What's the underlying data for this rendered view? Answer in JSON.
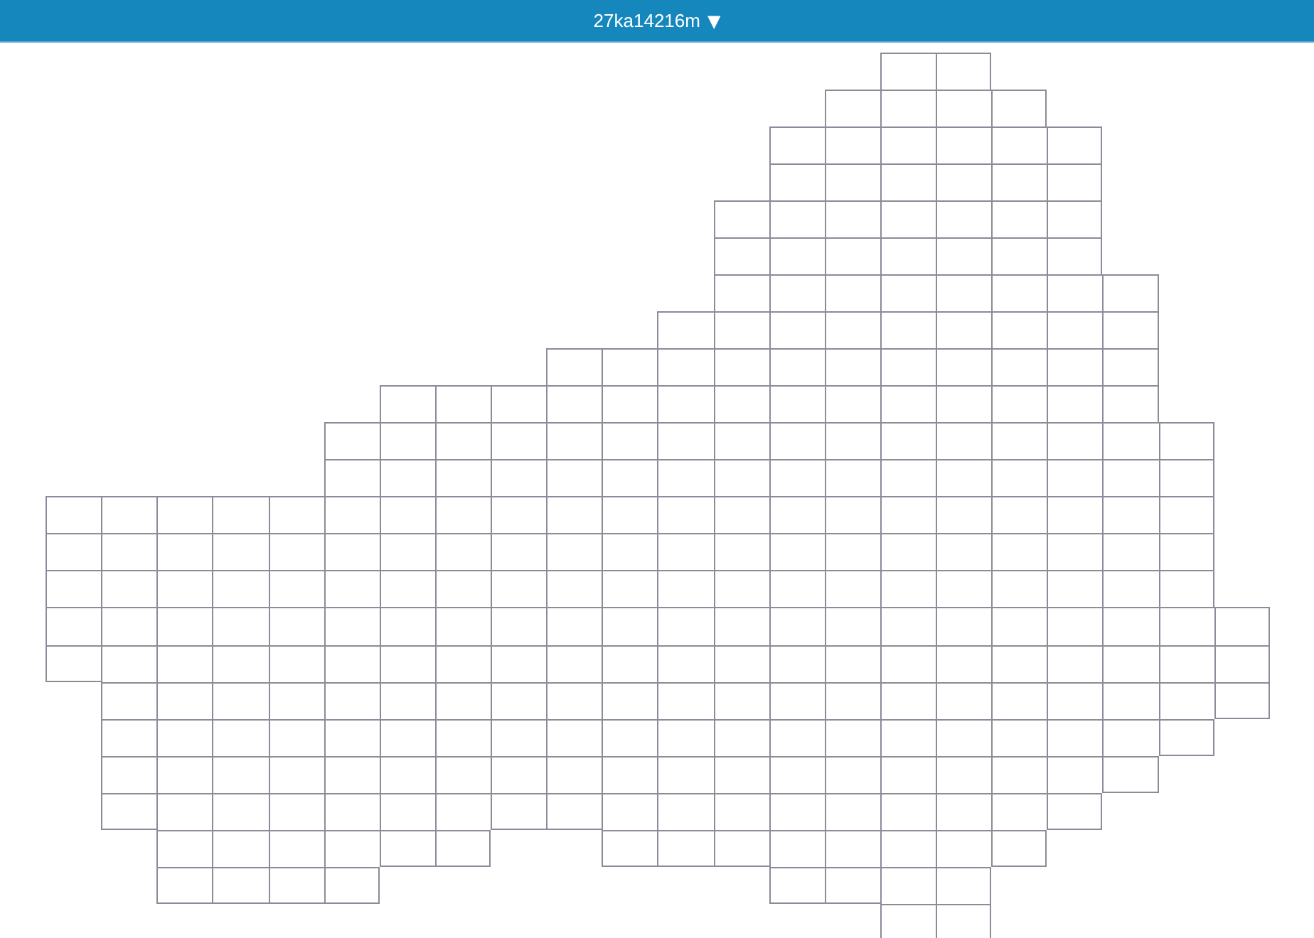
{
  "header": {
    "title": "27ka14216m",
    "caret": "▼"
  },
  "grid": {
    "rows": [
      [
        {
          "kind": "gap"
        },
        {
          "kind": "gap"
        },
        {
          "kind": "gap"
        },
        {
          "kind": "gap"
        },
        {
          "kind": "gap"
        },
        {
          "kind": "gap"
        },
        {
          "kind": "gap"
        },
        {
          "kind": "gap"
        },
        {
          "kind": "gap"
        },
        {
          "kind": "gap"
        },
        {
          "kind": "gap"
        },
        {
          "kind": "gap"
        },
        {
          "kind": "gap"
        },
        {
          "kind": "gap"
        },
        {
          "kind": "gap"
        },
        {
          "kind": "tile"
        },
        {
          "kind": "tile"
        }
      ],
      [
        {
          "kind": "gap"
        },
        {
          "kind": "gap"
        },
        {
          "kind": "gap"
        },
        {
          "kind": "gap"
        },
        {
          "kind": "gap"
        },
        {
          "kind": "gap"
        },
        {
          "kind": "gap"
        },
        {
          "kind": "gap"
        },
        {
          "kind": "gap"
        },
        {
          "kind": "gap"
        },
        {
          "kind": "gap"
        },
        {
          "kind": "gap"
        },
        {
          "kind": "gap"
        },
        {
          "kind": "gap"
        },
        {
          "kind": "tile"
        },
        {
          "kind": "tile"
        },
        {
          "kind": "tile"
        },
        {
          "kind": "tile"
        }
      ],
      [
        {
          "kind": "gap"
        },
        {
          "kind": "gap"
        },
        {
          "kind": "gap"
        },
        {
          "kind": "gap"
        },
        {
          "kind": "gap"
        },
        {
          "kind": "gap"
        },
        {
          "kind": "gap"
        },
        {
          "kind": "gap"
        },
        {
          "kind": "gap"
        },
        {
          "kind": "gap"
        },
        {
          "kind": "gap"
        },
        {
          "kind": "gap"
        },
        {
          "kind": "gap"
        },
        {
          "kind": "tile"
        },
        {
          "kind": "tile"
        },
        {
          "kind": "tile"
        },
        {
          "kind": "tile"
        },
        {
          "kind": "tile"
        },
        {
          "kind": "tile"
        }
      ],
      [
        {
          "kind": "gap"
        },
        {
          "kind": "gap"
        },
        {
          "kind": "gap"
        },
        {
          "kind": "gap"
        },
        {
          "kind": "gap"
        },
        {
          "kind": "gap"
        },
        {
          "kind": "gap"
        },
        {
          "kind": "gap"
        },
        {
          "kind": "gap"
        },
        {
          "kind": "gap"
        },
        {
          "kind": "gap"
        },
        {
          "kind": "gap"
        },
        {
          "kind": "gap"
        },
        {
          "kind": "tile"
        },
        {
          "kind": "tile"
        },
        {
          "kind": "tile"
        },
        {
          "kind": "tile"
        },
        {
          "kind": "tile"
        },
        {
          "kind": "tile"
        }
      ],
      [
        {
          "kind": "gap"
        },
        {
          "kind": "gap"
        },
        {
          "kind": "gap"
        },
        {
          "kind": "gap"
        },
        {
          "kind": "gap"
        },
        {
          "kind": "gap"
        },
        {
          "kind": "gap"
        },
        {
          "kind": "gap"
        },
        {
          "kind": "gap"
        },
        {
          "kind": "gap"
        },
        {
          "kind": "gap"
        },
        {
          "kind": "gap"
        },
        {
          "kind": "tile"
        },
        {
          "kind": "tile"
        },
        {
          "kind": "tile"
        },
        {
          "kind": "tile"
        },
        {
          "kind": "tile"
        },
        {
          "kind": "tile"
        },
        {
          "kind": "tile"
        }
      ],
      [
        {
          "kind": "gap"
        },
        {
          "kind": "gap"
        },
        {
          "kind": "gap"
        },
        {
          "kind": "gap"
        },
        {
          "kind": "gap"
        },
        {
          "kind": "gap"
        },
        {
          "kind": "gap"
        },
        {
          "kind": "gap"
        },
        {
          "kind": "gap"
        },
        {
          "kind": "gap"
        },
        {
          "kind": "gap"
        },
        {
          "kind": "gap"
        },
        {
          "kind": "tile"
        },
        {
          "kind": "tile"
        },
        {
          "kind": "tile"
        },
        {
          "kind": "tile"
        },
        {
          "kind": "tile"
        },
        {
          "kind": "tile"
        },
        {
          "kind": "tile"
        }
      ],
      [
        {
          "kind": "gap"
        },
        {
          "kind": "gap"
        },
        {
          "kind": "gap"
        },
        {
          "kind": "gap"
        },
        {
          "kind": "gap"
        },
        {
          "kind": "gap"
        },
        {
          "kind": "gap"
        },
        {
          "kind": "gap"
        },
        {
          "kind": "gap"
        },
        {
          "kind": "gap"
        },
        {
          "kind": "gap"
        },
        {
          "kind": "gap"
        },
        {
          "kind": "tile"
        },
        {
          "kind": "tile"
        },
        {
          "kind": "tile"
        },
        {
          "kind": "tile"
        },
        {
          "kind": "tile"
        },
        {
          "kind": "tile"
        },
        {
          "kind": "tile"
        },
        {
          "kind": "tile"
        }
      ],
      [
        {
          "kind": "gap"
        },
        {
          "kind": "gap"
        },
        {
          "kind": "gap"
        },
        {
          "kind": "gap"
        },
        {
          "kind": "gap"
        },
        {
          "kind": "gap"
        },
        {
          "kind": "gap"
        },
        {
          "kind": "gap"
        },
        {
          "kind": "gap"
        },
        {
          "kind": "gap"
        },
        {
          "kind": "gap"
        },
        {
          "kind": "tile"
        },
        {
          "kind": "tile"
        },
        {
          "kind": "tile"
        },
        {
          "kind": "tile"
        },
        {
          "kind": "tile"
        },
        {
          "kind": "tile"
        },
        {
          "kind": "tile"
        },
        {
          "kind": "tile"
        },
        {
          "kind": "tile"
        }
      ],
      [
        {
          "kind": "gap"
        },
        {
          "kind": "gap"
        },
        {
          "kind": "gap"
        },
        {
          "kind": "gap"
        },
        {
          "kind": "gap"
        },
        {
          "kind": "gap"
        },
        {
          "kind": "gap"
        },
        {
          "kind": "gap"
        },
        {
          "kind": "gap"
        },
        {
          "kind": "tile"
        },
        {
          "kind": "tile"
        },
        {
          "kind": "tile"
        },
        {
          "kind": "tile"
        },
        {
          "kind": "tile"
        },
        {
          "kind": "tile"
        },
        {
          "kind": "tile"
        },
        {
          "kind": "tile"
        },
        {
          "kind": "tile"
        },
        {
          "kind": "tile"
        },
        {
          "kind": "tile"
        }
      ],
      [
        {
          "kind": "gap"
        },
        {
          "kind": "gap"
        },
        {
          "kind": "gap"
        },
        {
          "kind": "gap"
        },
        {
          "kind": "gap"
        },
        {
          "kind": "gap"
        },
        {
          "kind": "tile"
        },
        {
          "kind": "tile"
        },
        {
          "kind": "tile"
        },
        {
          "kind": "tile"
        },
        {
          "kind": "tile"
        },
        {
          "kind": "tile"
        },
        {
          "kind": "tile"
        },
        {
          "kind": "tile"
        },
        {
          "kind": "tile"
        },
        {
          "kind": "tile"
        },
        {
          "kind": "tile"
        },
        {
          "kind": "tile"
        },
        {
          "kind": "tile"
        },
        {
          "kind": "tile"
        }
      ],
      [
        {
          "kind": "gap"
        },
        {
          "kind": "gap"
        },
        {
          "kind": "gap"
        },
        {
          "kind": "gap"
        },
        {
          "kind": "gap"
        },
        {
          "kind": "tile"
        },
        {
          "kind": "tile"
        },
        {
          "kind": "tile"
        },
        {
          "kind": "tile"
        },
        {
          "kind": "tile"
        },
        {
          "kind": "tile"
        },
        {
          "kind": "tile"
        },
        {
          "kind": "tile"
        },
        {
          "kind": "tile"
        },
        {
          "kind": "tile"
        },
        {
          "kind": "tile"
        },
        {
          "kind": "tile"
        },
        {
          "kind": "tile"
        },
        {
          "kind": "tile"
        },
        {
          "kind": "tile"
        },
        {
          "kind": "tile"
        }
      ],
      [
        {
          "kind": "gap"
        },
        {
          "kind": "gap"
        },
        {
          "kind": "gap"
        },
        {
          "kind": "gap"
        },
        {
          "kind": "gap"
        },
        {
          "kind": "tile"
        },
        {
          "kind": "tile"
        },
        {
          "kind": "tile"
        },
        {
          "kind": "tile"
        },
        {
          "kind": "tile"
        },
        {
          "kind": "tile"
        },
        {
          "kind": "tile"
        },
        {
          "kind": "tile"
        },
        {
          "kind": "tile"
        },
        {
          "kind": "tile"
        },
        {
          "kind": "tile"
        },
        {
          "kind": "tile"
        },
        {
          "kind": "tile"
        },
        {
          "kind": "tile"
        },
        {
          "kind": "tile"
        },
        {
          "kind": "tile"
        }
      ],
      [
        {
          "kind": "tile"
        },
        {
          "kind": "tile"
        },
        {
          "kind": "tile"
        },
        {
          "kind": "tile"
        },
        {
          "kind": "tile"
        },
        {
          "kind": "tile"
        },
        {
          "kind": "tile"
        },
        {
          "kind": "tile"
        },
        {
          "kind": "tile"
        },
        {
          "kind": "tile"
        },
        {
          "kind": "tile"
        },
        {
          "kind": "tile"
        },
        {
          "kind": "tile"
        },
        {
          "kind": "tile"
        },
        {
          "kind": "tile"
        },
        {
          "kind": "tile"
        },
        {
          "kind": "tile"
        },
        {
          "kind": "tile"
        },
        {
          "kind": "tile"
        },
        {
          "kind": "tile"
        },
        {
          "kind": "tile"
        }
      ],
      [
        {
          "kind": "tile"
        },
        {
          "kind": "tile"
        },
        {
          "kind": "tile"
        },
        {
          "kind": "tile"
        },
        {
          "kind": "tile"
        },
        {
          "kind": "tile"
        },
        {
          "kind": "tile"
        },
        {
          "kind": "tile"
        },
        {
          "kind": "tile"
        },
        {
          "kind": "tile"
        },
        {
          "kind": "tile"
        },
        {
          "kind": "tile"
        },
        {
          "kind": "tile"
        },
        {
          "kind": "tile"
        },
        {
          "kind": "tile"
        },
        {
          "kind": "tile"
        },
        {
          "kind": "tile"
        },
        {
          "kind": "tile"
        },
        {
          "kind": "tile"
        },
        {
          "kind": "tile"
        },
        {
          "kind": "tile"
        }
      ],
      [
        {
          "kind": "tile"
        },
        {
          "kind": "tile"
        },
        {
          "kind": "tile"
        },
        {
          "kind": "tile"
        },
        {
          "kind": "tile"
        },
        {
          "kind": "tile"
        },
        {
          "kind": "tile"
        },
        {
          "kind": "tile"
        },
        {
          "kind": "tile"
        },
        {
          "kind": "tile"
        },
        {
          "kind": "tile"
        },
        {
          "kind": "tile"
        },
        {
          "kind": "tile"
        },
        {
          "kind": "tile"
        },
        {
          "kind": "tile"
        },
        {
          "kind": "tile"
        },
        {
          "kind": "tile"
        },
        {
          "kind": "tile"
        },
        {
          "kind": "tile"
        },
        {
          "kind": "tile"
        },
        {
          "kind": "tile"
        }
      ],
      [
        {
          "kind": "tile"
        },
        {
          "kind": "tile"
        },
        {
          "kind": "tile"
        },
        {
          "kind": "tile"
        },
        {
          "kind": "tile"
        },
        {
          "kind": "tile"
        },
        {
          "kind": "tile"
        },
        {
          "kind": "tile"
        },
        {
          "kind": "tile"
        },
        {
          "kind": "tile"
        },
        {
          "kind": "tile"
        },
        {
          "kind": "tile"
        },
        {
          "kind": "tile"
        },
        {
          "kind": "tile"
        },
        {
          "kind": "tile"
        },
        {
          "kind": "tile"
        },
        {
          "kind": "tile"
        },
        {
          "kind": "tile"
        },
        {
          "kind": "tile"
        },
        {
          "kind": "tile"
        },
        {
          "kind": "tile"
        },
        {
          "kind": "tile"
        }
      ],
      [
        {
          "kind": "tile"
        },
        {
          "kind": "tile"
        },
        {
          "kind": "tile"
        },
        {
          "kind": "tile"
        },
        {
          "kind": "tile"
        },
        {
          "kind": "tile"
        },
        {
          "kind": "tile"
        },
        {
          "kind": "tile"
        },
        {
          "kind": "tile"
        },
        {
          "kind": "tile"
        },
        {
          "kind": "tile"
        },
        {
          "kind": "tile"
        },
        {
          "kind": "tile"
        },
        {
          "kind": "tile"
        },
        {
          "kind": "tile"
        },
        {
          "kind": "tile"
        },
        {
          "kind": "tile"
        },
        {
          "kind": "tile"
        },
        {
          "kind": "tile"
        },
        {
          "kind": "tile"
        },
        {
          "kind": "tile"
        },
        {
          "kind": "tile"
        }
      ],
      [
        {
          "kind": "gap"
        },
        {
          "kind": "tile"
        },
        {
          "kind": "tile"
        },
        {
          "kind": "tile"
        },
        {
          "kind": "tile"
        },
        {
          "kind": "tile"
        },
        {
          "kind": "tile"
        },
        {
          "kind": "tile"
        },
        {
          "kind": "tile"
        },
        {
          "kind": "tile"
        },
        {
          "kind": "tile"
        },
        {
          "kind": "tile"
        },
        {
          "kind": "tile"
        },
        {
          "kind": "tile"
        },
        {
          "kind": "tile"
        },
        {
          "kind": "tile"
        },
        {
          "kind": "tile"
        },
        {
          "kind": "tile"
        },
        {
          "kind": "tile"
        },
        {
          "kind": "tile"
        },
        {
          "kind": "tile"
        },
        {
          "kind": "tile"
        }
      ],
      [
        {
          "kind": "gap"
        },
        {
          "kind": "tile"
        },
        {
          "kind": "tile"
        },
        {
          "kind": "tile"
        },
        {
          "kind": "tile"
        },
        {
          "kind": "tile"
        },
        {
          "kind": "tile"
        },
        {
          "kind": "tile"
        },
        {
          "kind": "tile"
        },
        {
          "kind": "tile"
        },
        {
          "kind": "tile"
        },
        {
          "kind": "tile"
        },
        {
          "kind": "tile"
        },
        {
          "kind": "tile"
        },
        {
          "kind": "tile"
        },
        {
          "kind": "tile"
        },
        {
          "kind": "tile"
        },
        {
          "kind": "tile"
        },
        {
          "kind": "tile"
        },
        {
          "kind": "tile"
        },
        {
          "kind": "tile"
        }
      ],
      [
        {
          "kind": "gap"
        },
        {
          "kind": "tile"
        },
        {
          "kind": "tile"
        },
        {
          "kind": "tile"
        },
        {
          "kind": "tile"
        },
        {
          "kind": "tile"
        },
        {
          "kind": "tile"
        },
        {
          "kind": "tile"
        },
        {
          "kind": "tile"
        },
        {
          "kind": "tile"
        },
        {
          "kind": "tile"
        },
        {
          "kind": "tile"
        },
        {
          "kind": "tile"
        },
        {
          "kind": "tile"
        },
        {
          "kind": "tile"
        },
        {
          "kind": "tile"
        },
        {
          "kind": "tile"
        },
        {
          "kind": "tile"
        },
        {
          "kind": "tile"
        },
        {
          "kind": "tile"
        }
      ],
      [
        {
          "kind": "gap"
        },
        {
          "kind": "tile"
        },
        {
          "kind": "tile"
        },
        {
          "kind": "tile"
        },
        {
          "kind": "tile"
        },
        {
          "kind": "tile"
        },
        {
          "kind": "tile"
        },
        {
          "kind": "tile"
        },
        {
          "kind": "tile"
        },
        {
          "kind": "tile"
        },
        {
          "kind": "tile"
        },
        {
          "kind": "tile"
        },
        {
          "kind": "tile"
        },
        {
          "kind": "tile"
        },
        {
          "kind": "tile"
        },
        {
          "kind": "tile"
        },
        {
          "kind": "tile"
        },
        {
          "kind": "tile"
        },
        {
          "kind": "tile"
        }
      ],
      [
        {
          "kind": "gap"
        },
        {
          "kind": "gap"
        },
        {
          "kind": "tile"
        },
        {
          "kind": "tile"
        },
        {
          "kind": "tile"
        },
        {
          "kind": "tile"
        },
        {
          "kind": "tile"
        },
        {
          "kind": "tile"
        },
        {
          "kind": "gap"
        },
        {
          "kind": "gap"
        },
        {
          "kind": "tile"
        },
        {
          "kind": "tile"
        },
        {
          "kind": "tile"
        },
        {
          "kind": "tile"
        },
        {
          "kind": "tile"
        },
        {
          "kind": "tile"
        },
        {
          "kind": "tile"
        },
        {
          "kind": "tile"
        }
      ],
      [
        {
          "kind": "gap"
        },
        {
          "kind": "gap"
        },
        {
          "kind": "tile"
        },
        {
          "kind": "tile"
        },
        {
          "kind": "tile"
        },
        {
          "kind": "tile"
        },
        {
          "kind": "gap"
        },
        {
          "kind": "gap"
        },
        {
          "kind": "gap"
        },
        {
          "kind": "gap"
        },
        {
          "kind": "gap"
        },
        {
          "kind": "gap"
        },
        {
          "kind": "gap"
        },
        {
          "kind": "tile"
        },
        {
          "kind": "tile"
        },
        {
          "kind": "tile"
        },
        {
          "kind": "tile"
        }
      ],
      [
        {
          "kind": "gap"
        },
        {
          "kind": "gap"
        },
        {
          "kind": "gap"
        },
        {
          "kind": "gap"
        },
        {
          "kind": "gap"
        },
        {
          "kind": "gap"
        },
        {
          "kind": "gap"
        },
        {
          "kind": "gap"
        },
        {
          "kind": "gap"
        },
        {
          "kind": "gap"
        },
        {
          "kind": "gap"
        },
        {
          "kind": "gap"
        },
        {
          "kind": "gap"
        },
        {
          "kind": "gap"
        },
        {
          "kind": "gap"
        },
        {
          "kind": "tile"
        },
        {
          "kind": "tile"
        }
      ]
    ]
  }
}
